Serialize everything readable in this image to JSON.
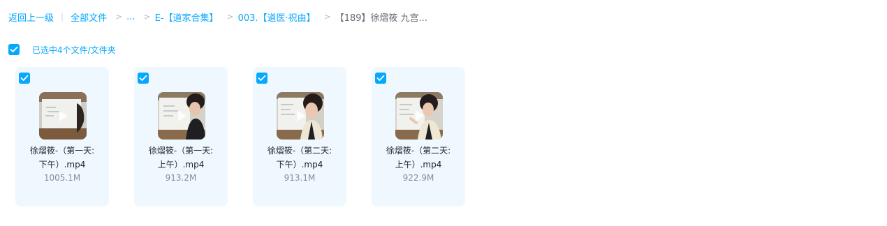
{
  "breadcrumb": {
    "back": "返回上一级",
    "all_files": "全部文件",
    "ellipsis": "...",
    "folder1": "E-【道家合集】",
    "folder2": "003.【道医·祝由】",
    "current": "【189】徐熠筱 九宫..."
  },
  "selection": {
    "text": "已选中4个文件/文件夹"
  },
  "files": [
    {
      "name_line1": "徐熠筱-（第一天:",
      "name_line2": "下午）.mp4",
      "size": "1005.1M"
    },
    {
      "name_line1": "徐熠筱-（第一天:",
      "name_line2": "上午）.mp4",
      "size": "913.2M"
    },
    {
      "name_line1": "徐熠筱-（第二天:",
      "name_line2": "下午）.mp4",
      "size": "913.1M"
    },
    {
      "name_line1": "徐熠筱-（第二天:",
      "name_line2": "上午）.mp4",
      "size": "922.9M"
    }
  ],
  "colors": {
    "accent": "#06a7ff",
    "card_bg": "#eef8fe",
    "text": "#1f2329",
    "muted": "#878c9c"
  },
  "icons": {
    "checkbox": "checkmark-icon",
    "video": "play-icon"
  }
}
